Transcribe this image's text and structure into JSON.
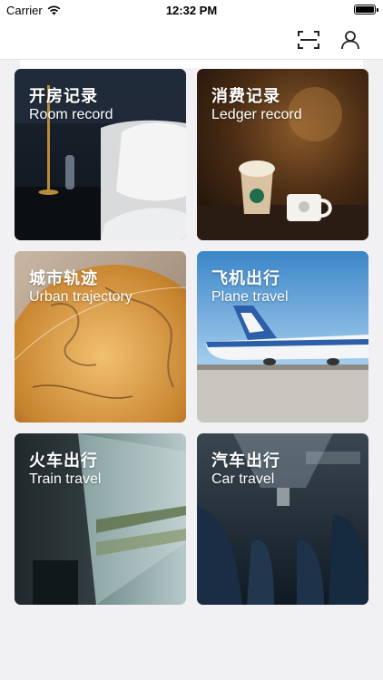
{
  "status_bar": {
    "carrier": "Carrier",
    "time": "12:32 PM",
    "icons": [
      "wifi-icon",
      "battery-icon"
    ]
  },
  "navbar": {
    "icons": [
      "scan-icon",
      "user-icon"
    ]
  },
  "cards": [
    {
      "title_cn": "开房记录",
      "title_en": "Room record",
      "image": "hotel-bed-photo"
    },
    {
      "title_cn": "消费记录",
      "title_en": "Ledger record",
      "image": "coffee-cups-photo"
    },
    {
      "title_cn": "城市轨迹",
      "title_en": "Urban trajectory",
      "image": "globe-photo"
    },
    {
      "title_cn": "飞机出行",
      "title_en": "Plane travel",
      "image": "airplane-photo"
    },
    {
      "title_cn": "火车出行",
      "title_en": "Train travel",
      "image": "train-window-photo"
    },
    {
      "title_cn": "汽车出行",
      "title_en": "Car travel",
      "image": "bus-interior-photo"
    }
  ]
}
